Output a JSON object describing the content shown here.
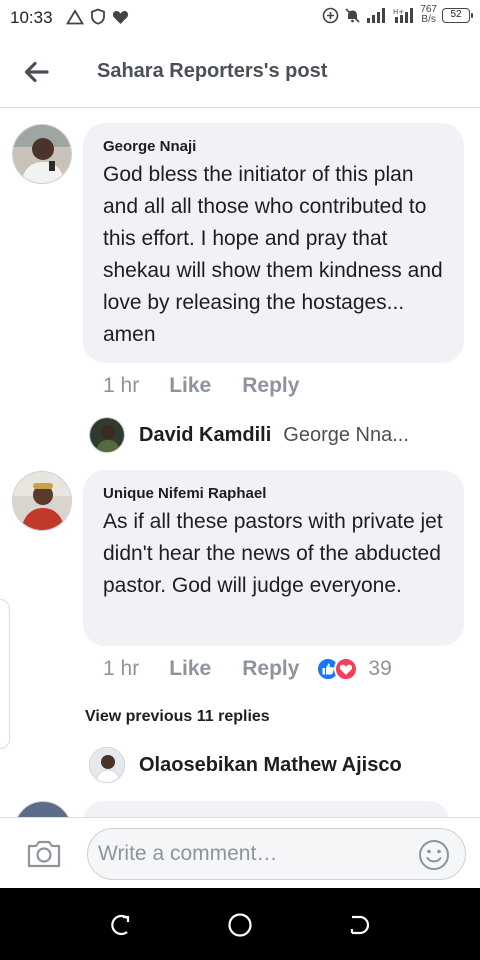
{
  "status_bar": {
    "time": "10:33",
    "speed_value": "767",
    "speed_unit": "B/s",
    "battery": "52"
  },
  "header": {
    "title": "Sahara Reporters's post"
  },
  "comments": [
    {
      "author": "George Nnaji",
      "text": "God bless the initiator of this plan and all all those who contributed to this effort. I hope and pray that shekau will show them kindness and love by releasing the hostages... amen",
      "time": "1 hr",
      "like_label": "Like",
      "reply_label": "Reply",
      "reply_preview": {
        "author": "David Kamdili",
        "snippet": "George Nna..."
      }
    },
    {
      "author": "Unique Nifemi Raphael",
      "text": "As if all these pastors with private jet didn't hear the news of the abducted pastor. God will judge everyone.",
      "time": "1 hr",
      "like_label": "Like",
      "reply_label": "Reply",
      "reaction_count": "39",
      "reactions": [
        "like-icon",
        "love-icon"
      ],
      "view_previous_label": "View previous 11 replies",
      "reply_preview": {
        "author": "Olaosebikan Mathew Ajisco"
      }
    }
  ],
  "composer": {
    "placeholder": "Write a comment…"
  },
  "colors": {
    "bubble": "#f0f2f5",
    "like_blue": "#1877f2",
    "love_red": "#f33e58",
    "muted": "#8d949e"
  }
}
